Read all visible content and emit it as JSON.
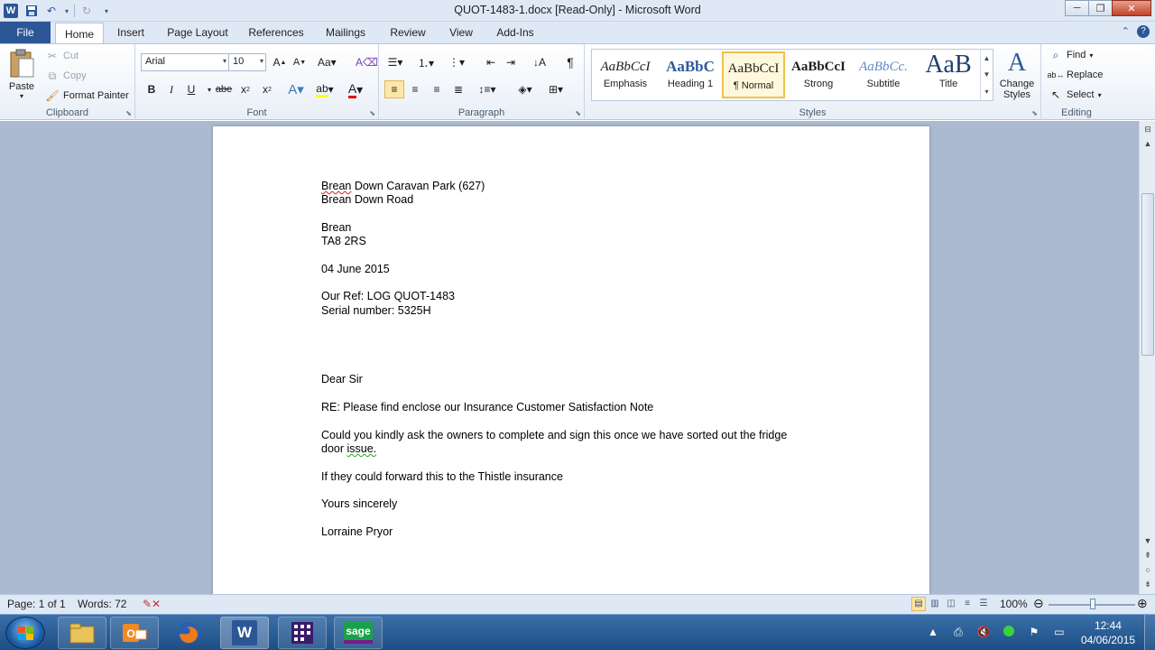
{
  "window": {
    "title": "QUOT-1483-1.docx [Read-Only]  -  Microsoft Word",
    "app_logo": "W"
  },
  "tabs": {
    "file": "File",
    "items": [
      "Home",
      "Insert",
      "Page Layout",
      "References",
      "Mailings",
      "Review",
      "View",
      "Add-Ins"
    ],
    "active": "Home"
  },
  "ribbon": {
    "clipboard": {
      "label": "Clipboard",
      "paste": "Paste",
      "cut": "Cut",
      "copy": "Copy",
      "format_painter": "Format Painter"
    },
    "font": {
      "label": "Font",
      "font_name": "Arial",
      "font_size": "10"
    },
    "paragraph": {
      "label": "Paragraph"
    },
    "styles": {
      "label": "Styles",
      "items": [
        {
          "sample": "AaBbCcI",
          "name": "Emphasis"
        },
        {
          "sample": "AaBbC",
          "name": "Heading 1"
        },
        {
          "sample": "AaBbCcI",
          "name": "¶ Normal"
        },
        {
          "sample": "AaBbCcI",
          "name": "Strong"
        },
        {
          "sample": "AaBbCc.",
          "name": "Subtitle"
        },
        {
          "sample": "AaB",
          "name": "Title"
        }
      ],
      "change_styles": "Change Styles"
    },
    "editing": {
      "label": "Editing",
      "find": "Find",
      "replace": "Replace",
      "select": "Select"
    }
  },
  "document": {
    "lines": {
      "addr1_word": "Brean",
      "addr1_rest": " Down  Caravan  Park (627)",
      "addr2": "Brean Down Road",
      "addr3": "Brean",
      "addr4": "TA8 2RS",
      "date": "04 June 2015",
      "ref": "Our Ref: LOG QUOT-1483",
      "serial": "Serial number: 5325H",
      "greeting": "Dear Sir",
      "re": "RE: Please find enclose our Insurance  Customer Satisfaction Note",
      "body1a": "Could you kindly ask the owners to complete and sign this once we have sorted out the fridge",
      "body1b_a": "door ",
      "body1b_b": "issue.",
      "body2": "If they could forward this to the Thistle insurance",
      "closing": "Yours sincerely",
      "signature": "Lorraine  Pryor"
    }
  },
  "statusbar": {
    "page": "Page: 1 of 1",
    "words": "Words: 72",
    "zoom": "100%"
  },
  "taskbar": {
    "apps": [
      "explorer",
      "outlook",
      "firefox",
      "word",
      "calculator-grid",
      "sage"
    ],
    "sage_label": "sage",
    "word_label": "W",
    "time": "12:44",
    "date": "04/06/2015"
  }
}
